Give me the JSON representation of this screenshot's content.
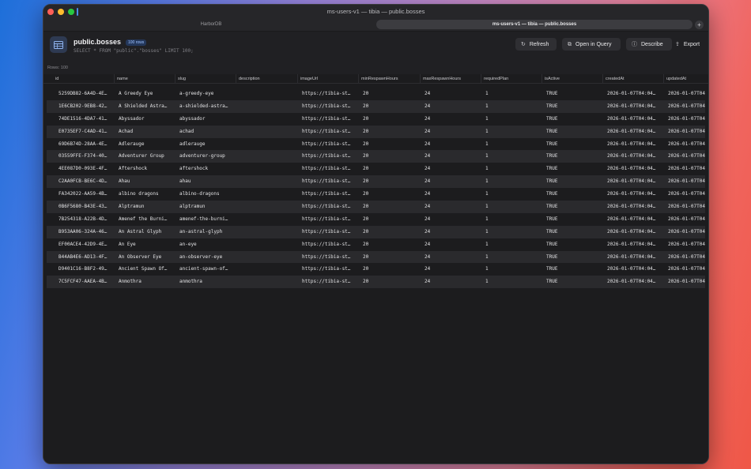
{
  "window": {
    "title": "ms-users-v1 — tibia — public.bosses"
  },
  "tabs": [
    {
      "label": "HarborDB"
    },
    {
      "label": "ms-users-v1 — tibia — public.bosses"
    }
  ],
  "header": {
    "table_name": "public.bosses",
    "rows_badge": "100 rows",
    "query": "SELECT * FROM \"public\".\"bosses\" LIMIT 100;",
    "refresh_label": "Refresh",
    "open_in_query_label": "Open in Query",
    "describe_label": "Describe",
    "export_label": "Export"
  },
  "rows_count": "Rows: 100",
  "table": {
    "columns": [
      "id",
      "name",
      "slug",
      "description",
      "imageUrl",
      "minRespawnHours",
      "maxRespawnHours",
      "requiredPlan",
      "isActive",
      "createdAt",
      "updatedAt"
    ],
    "rows": [
      [
        "5259DB82-6A4D-4E…",
        "A Greedy Eye",
        "a-greedy-eye",
        "",
        "https://tibia-st…",
        "20",
        "24",
        "1",
        "TRUE",
        "2026-01-07T04:04…",
        "2026-01-07T04"
      ],
      [
        "1E6CB202-9EB8-42…",
        "A Shielded Astra…",
        "a-shielded-astra…",
        "",
        "https://tibia-st…",
        "20",
        "24",
        "1",
        "TRUE",
        "2026-01-07T04:04…",
        "2026-01-07T04"
      ],
      [
        "74DE1516-4DA7-41…",
        "Abyssador",
        "abyssador",
        "",
        "https://tibia-st…",
        "20",
        "24",
        "1",
        "TRUE",
        "2026-01-07T04:04…",
        "2026-01-07T04"
      ],
      [
        "E0735EF7-C4AD-41…",
        "Achad",
        "achad",
        "",
        "https://tibia-st…",
        "20",
        "24",
        "1",
        "TRUE",
        "2026-01-07T04:04…",
        "2026-01-07T04"
      ],
      [
        "69D6B74D-28AA-4E…",
        "Adlerauge",
        "adlerauge",
        "",
        "https://tibia-st…",
        "20",
        "24",
        "1",
        "TRUE",
        "2026-01-07T04:04…",
        "2026-01-07T04"
      ],
      [
        "03559FFE-F374-40…",
        "Adventurer Group",
        "adventurer-group",
        "",
        "https://tibia-st…",
        "20",
        "24",
        "1",
        "TRUE",
        "2026-01-07T04:04…",
        "2026-01-07T04"
      ],
      [
        "4EE087D0-093E-4F…",
        "Aftershock",
        "aftershock",
        "",
        "https://tibia-st…",
        "20",
        "24",
        "1",
        "TRUE",
        "2026-01-07T04:04…",
        "2026-01-07T04"
      ],
      [
        "C2AA0FCB-BE6C-4D…",
        "Ahau",
        "ahau",
        "",
        "https://tibia-st…",
        "20",
        "24",
        "1",
        "TRUE",
        "2026-01-07T04:04…",
        "2026-01-07T04"
      ],
      [
        "FA342022-AA59-4B…",
        "albino dragons",
        "albino-dragons",
        "",
        "https://tibia-st…",
        "20",
        "24",
        "1",
        "TRUE",
        "2026-01-07T04:04…",
        "2026-01-07T04"
      ],
      [
        "0B6F5680-B43E-43…",
        "Alptramun",
        "alptramun",
        "",
        "https://tibia-st…",
        "20",
        "24",
        "1",
        "TRUE",
        "2026-01-07T04:04…",
        "2026-01-07T04"
      ],
      [
        "7B254318-A22B-4D…",
        "Amenef the Burni…",
        "amenef-the-burni…",
        "",
        "https://tibia-st…",
        "20",
        "24",
        "1",
        "TRUE",
        "2026-01-07T04:04…",
        "2026-01-07T04"
      ],
      [
        "B953AA06-324A-46…",
        "An Astral Glyph",
        "an-astral-glyph",
        "",
        "https://tibia-st…",
        "20",
        "24",
        "1",
        "TRUE",
        "2026-01-07T04:04…",
        "2026-01-07T04"
      ],
      [
        "EF00ACE4-42D9-4E…",
        "An Eye",
        "an-eye",
        "",
        "https://tibia-st…",
        "20",
        "24",
        "1",
        "TRUE",
        "2026-01-07T04:04…",
        "2026-01-07T04"
      ],
      [
        "B44AB4E6-AD13-4F…",
        "An Observer Eye",
        "an-observer-eye",
        "",
        "https://tibia-st…",
        "20",
        "24",
        "1",
        "TRUE",
        "2026-01-07T04:04…",
        "2026-01-07T04"
      ],
      [
        "D9401C16-B8F2-49…",
        "Ancient Spawn Of…",
        "ancient-spawn-of…",
        "",
        "https://tibia-st…",
        "20",
        "24",
        "1",
        "TRUE",
        "2026-01-07T04:04…",
        "2026-01-07T04"
      ],
      [
        "7C5FCF47-AAEA-4B…",
        "Anmothra",
        "anmothra",
        "",
        "https://tibia-st…",
        "20",
        "24",
        "1",
        "TRUE",
        "2026-01-07T04:04…",
        "2026-01-07T04"
      ]
    ]
  },
  "icons": {
    "table": "table-icon",
    "refresh": "refresh-icon",
    "open_in_query": "open-in-query-icon",
    "describe": "info-icon",
    "export": "share-icon",
    "new_tab": "plus-icon"
  },
  "colors": {
    "accent": "#4a8de8",
    "window_bg": "#202023",
    "alt_row": "#2a2a2d"
  }
}
